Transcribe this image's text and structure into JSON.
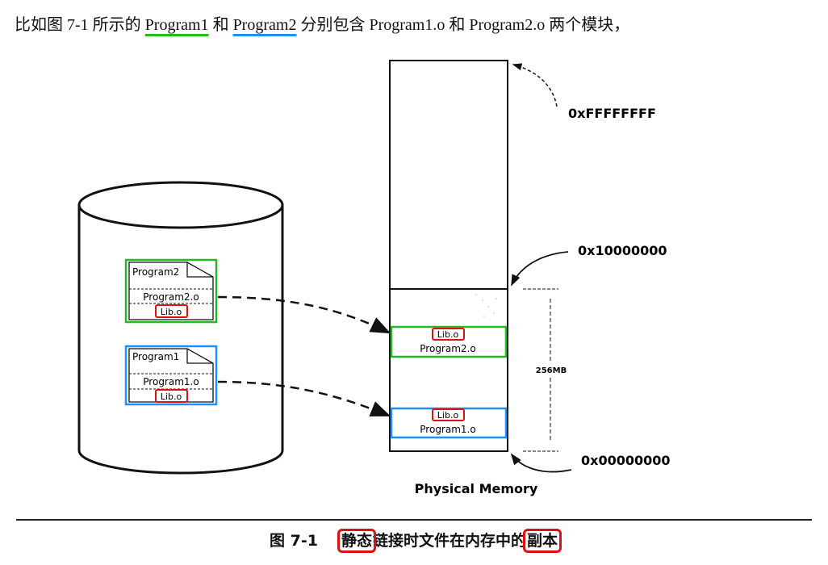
{
  "intro": {
    "prefix": "比如图 7-1 所示的 ",
    "program1": "Program1",
    "mid1": " 和 ",
    "program2": "Program2",
    "suffix": " 分别包含 Program1.o 和 Program2.o 两个模块，"
  },
  "disk": {
    "file2": {
      "title": "Program2",
      "module": "Program2.o",
      "lib": "Lib.o"
    },
    "file1": {
      "title": "Program1",
      "module": "Program1.o",
      "lib": "Lib.o"
    }
  },
  "memory": {
    "addr_top": "0xFFFFFFFF",
    "addr_mid": "0x10000000",
    "addr_bottom": "0x00000000",
    "size_label": "256MB",
    "title": "Physical Memory",
    "copy2": {
      "lib": "Lib.o",
      "module": "Program2.o"
    },
    "copy1": {
      "lib": "Lib.o",
      "module": "Program1.o"
    }
  },
  "caption": {
    "number": "图 7-1",
    "part1": "静态",
    "part2": "链接时文件在内存中的",
    "part3": "副本"
  },
  "colors": {
    "green": "#22bb22",
    "blue": "#1e90ff",
    "red": "#dd1111"
  }
}
